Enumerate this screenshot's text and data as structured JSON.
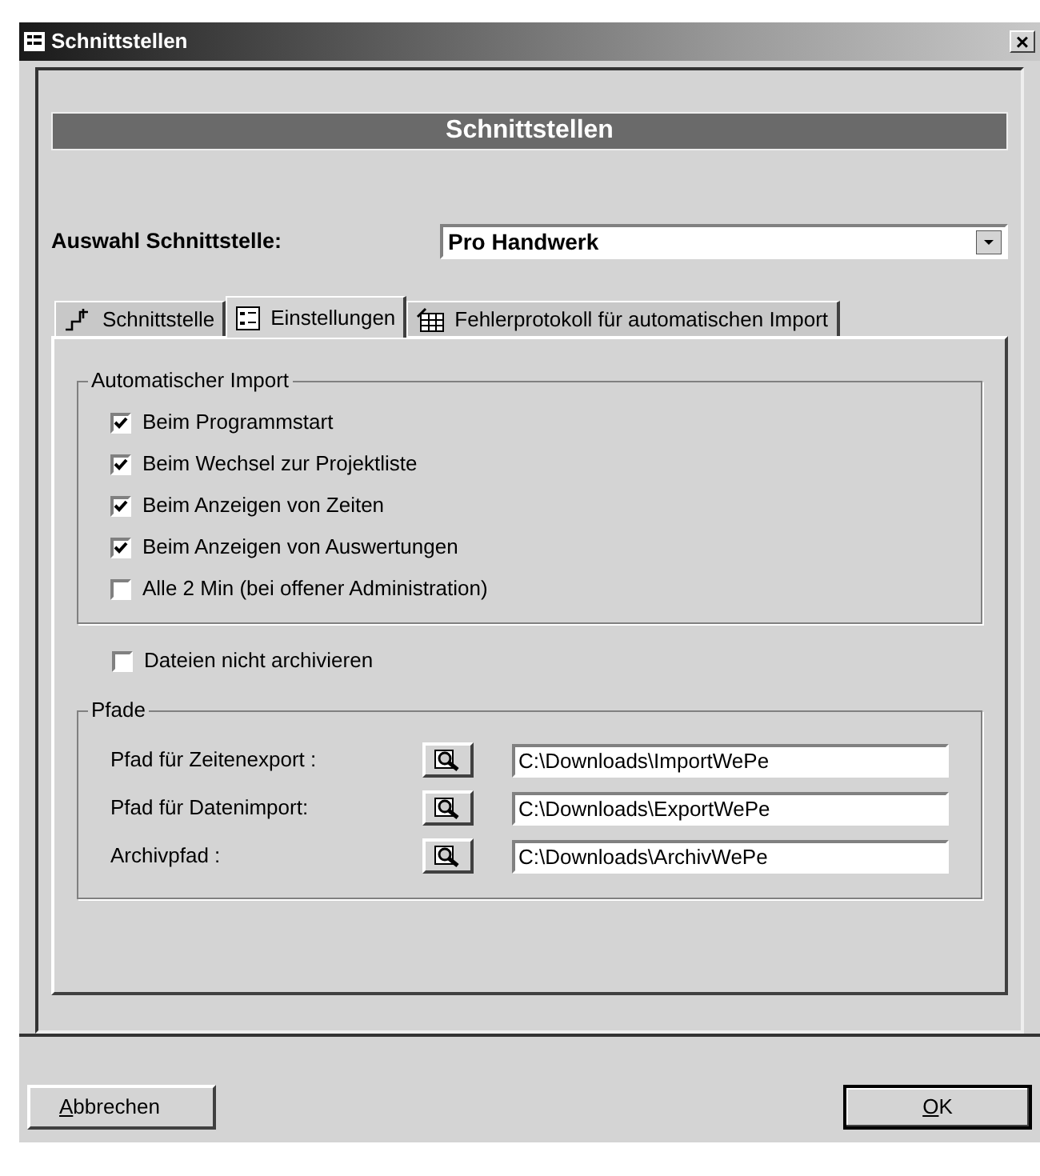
{
  "window": {
    "title": "Schnittstellen",
    "close": "×"
  },
  "header": "Schnittstellen",
  "interface_select": {
    "label": "Auswahl Schnittstelle:",
    "value": "Pro Handwerk"
  },
  "tabs": [
    {
      "label": "Schnittstelle",
      "selected": false,
      "kind": "chart"
    },
    {
      "label": "Einstellungen",
      "selected": true,
      "kind": "list"
    },
    {
      "label": "Fehlerprotokoll für automatischen Import",
      "selected": false,
      "kind": "table"
    }
  ],
  "auto_import": {
    "legend": "Automatischer Import",
    "options": [
      {
        "label": "Beim Programmstart",
        "checked": true
      },
      {
        "label": "Beim Wechsel zur Projektliste",
        "checked": true
      },
      {
        "label": "Beim Anzeigen von Zeiten",
        "checked": true
      },
      {
        "label": "Beim Anzeigen von Auswertungen",
        "checked": true
      },
      {
        "label": "Alle 2 Min (bei offener Administration)",
        "checked": false
      }
    ]
  },
  "no_archive": {
    "label": "Dateien nicht archivieren",
    "checked": false
  },
  "paths": {
    "legend": "Pfade",
    "rows": [
      {
        "label": "Pfad für Zeitenexport :",
        "value": "C:\\Downloads\\ImportWePe"
      },
      {
        "label": "Pfad für Datenimport:",
        "value": "C:\\Downloads\\ExportWePe"
      },
      {
        "label": "Archivpfad :",
        "value": "C:\\Downloads\\ArchivWePe"
      }
    ]
  },
  "buttons": [
    {
      "label": "Abbrechen",
      "mnemonic_underlined": true
    },
    {
      "label": "OK",
      "mnemonic_underlined": true
    }
  ]
}
